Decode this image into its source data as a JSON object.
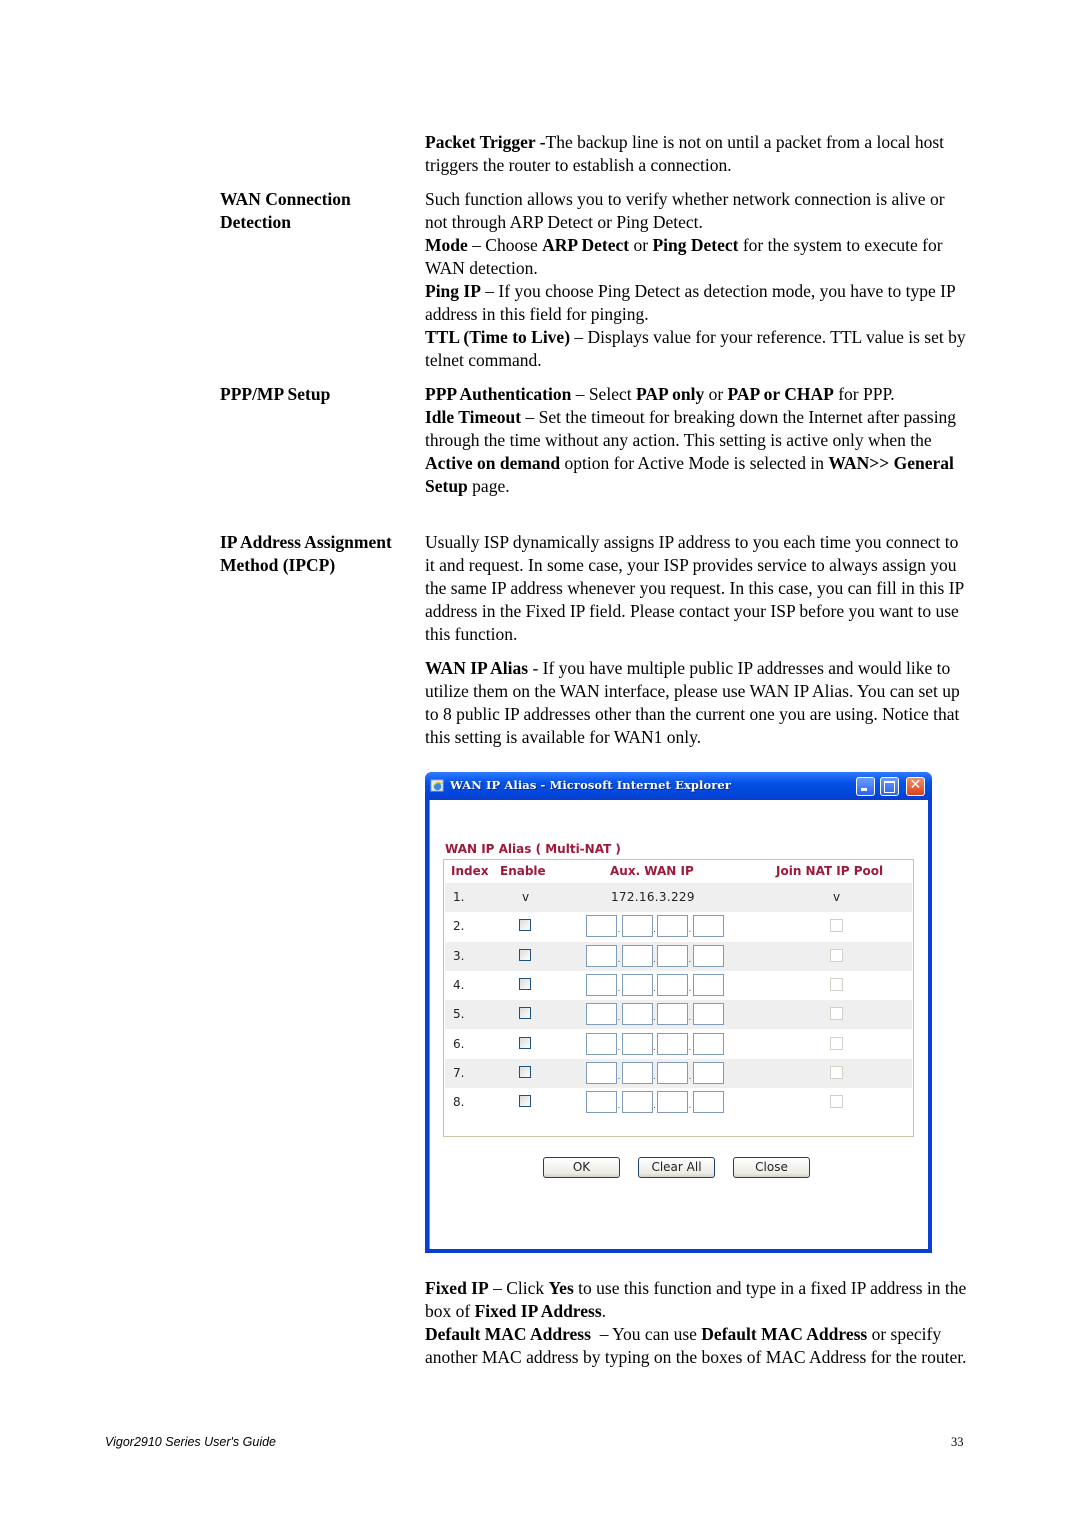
{
  "doc": {
    "packet_trigger": {
      "term": "Packet Trigger -",
      "text": "The backup line is not on until a packet from a local host triggers the router to establish a connection."
    },
    "sections": [
      {
        "label": "WAN Connection Detection"
      },
      {
        "label": "PPP/MP Setup"
      },
      {
        "label": "IP Address Assignment Method (IPCP)"
      }
    ],
    "wan_detect": {
      "intro": "Such function allows you to verify whether network connection is alive or not through ARP Detect or Ping Detect.",
      "mode_term": "Mode",
      "mode_a": " – Choose ",
      "mode_b": "ARP Detect",
      "mode_c": " or ",
      "mode_d": "Ping Detect",
      "mode_e": " for the system to execute for WAN detection.",
      "ping_term": "Ping IP",
      "ping_text": " – If you choose Ping Detect as detection mode, you have to type IP address in this field for pinging.",
      "ttl_term": "TTL (Time to Live)",
      "ttl_text": " – Displays value for your reference. TTL value is set by telnet command."
    },
    "ppp": {
      "auth_term": "PPP Authentication",
      "auth_a": " – Select ",
      "auth_b": "PAP only",
      "auth_c": " or ",
      "auth_d": "PAP or CHAP",
      "auth_e": " for PPP.",
      "idle_term": "Idle Timeout",
      "idle_a": " – Set the timeout for breaking down the Internet after passing through the time without any action. This setting is active only when the ",
      "idle_b": "Active on demand",
      "idle_c": " option for Active Mode is selected in ",
      "idle_d": "WAN>> General Setup",
      "idle_e": " page."
    },
    "ipcp": {
      "intro": "Usually ISP dynamically assigns IP address to you each time you connect to it and request. In some case, your ISP provides service to always assign you the same IP address whenever you request. In this case, you can fill in this IP address in the Fixed IP field. Please contact your ISP before you want to use this function.",
      "alias_term": "WAN IP Alias",
      "alias_text": " - If you have multiple public IP addresses and would like to utilize them on the WAN interface, please use WAN IP Alias. You can set up to 8 public IP addresses other than the current one you are using. Notice that this setting is available for WAN1 only.",
      "fixed_term": "Fixed IP",
      "fixed_a": " – Click ",
      "fixed_b": "Yes",
      "fixed_c": " to use this function and type in a fixed IP address in the box of ",
      "fixed_d": "Fixed IP Address",
      "fixed_e": ".",
      "mac_term": "Default MAC Address",
      "mac_a": "  – You can use ",
      "mac_b": "Default MAC Address",
      "mac_c": " or specify another MAC address by typing on the boxes of MAC Address for the router."
    },
    "footer": {
      "title": "Vigor2910 Series User's Guide",
      "page": "33"
    }
  },
  "dialog": {
    "window_title": "WAN IP Alias - Microsoft Internet Explorer",
    "icons": [
      "ie-icon",
      "minimize-icon",
      "maximize-icon",
      "close-icon"
    ],
    "close_glyph": "✕",
    "section_title": "WAN IP Alias ( Multi-NAT )",
    "headers": {
      "index": "Index",
      "enable": "Enable",
      "aux_ip": "Aux. WAN IP",
      "join": "Join NAT IP Pool"
    },
    "rows": [
      {
        "index": "1.",
        "enable": "v",
        "ip": "172.16.3.229",
        "join": "v"
      },
      {
        "index": "2.",
        "enable": false,
        "ip": [
          "",
          "",
          "",
          ""
        ],
        "join": false
      },
      {
        "index": "3.",
        "enable": false,
        "ip": [
          "",
          "",
          "",
          ""
        ],
        "join": false
      },
      {
        "index": "4.",
        "enable": false,
        "ip": [
          "",
          "",
          "",
          ""
        ],
        "join": false
      },
      {
        "index": "5.",
        "enable": false,
        "ip": [
          "",
          "",
          "",
          ""
        ],
        "join": false
      },
      {
        "index": "6.",
        "enable": false,
        "ip": [
          "",
          "",
          "",
          ""
        ],
        "join": false
      },
      {
        "index": "7.",
        "enable": false,
        "ip": [
          "",
          "",
          "",
          ""
        ],
        "join": false
      },
      {
        "index": "8.",
        "enable": false,
        "ip": [
          "",
          "",
          "",
          ""
        ],
        "join": false
      }
    ],
    "ip_separator": ".",
    "buttons": {
      "ok": "OK",
      "clear_all": "Clear All",
      "close": "Close"
    },
    "colors": {
      "frame": "#0a3fd6",
      "accent_text": "#9c1a3a",
      "row_alt": "#efefef"
    }
  }
}
